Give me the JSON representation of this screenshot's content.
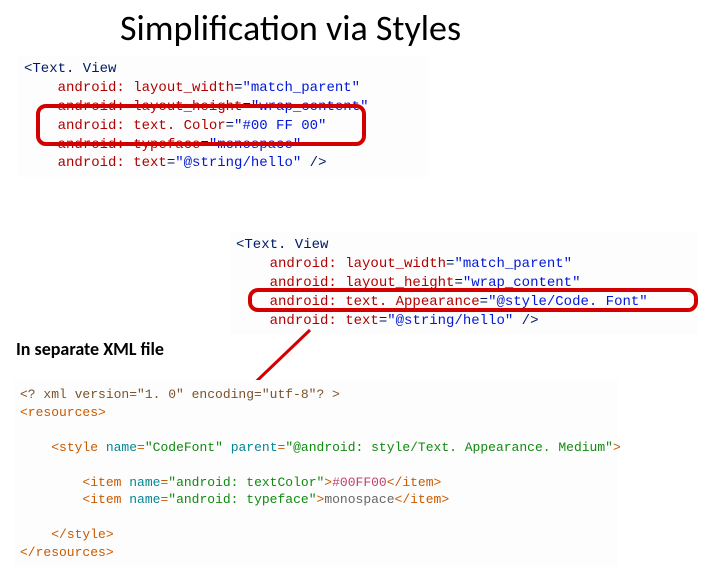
{
  "title": "Simplification via Styles",
  "caption": "In separate XML file",
  "block1": {
    "l1_open": "<Text. View",
    "l2_attr": "android: layout_width",
    "l2_val": "\"match_parent\"",
    "l3_attr": "android: layout_height",
    "l3_val": "\"wrap_content\"",
    "l4_attr": "android: text. Color",
    "l4_val": "\"#00 FF 00\"",
    "l5_attr": "android: typeface",
    "l5_val": "\"monospace\"",
    "l6_attr": "android: text",
    "l6_val": "\"@string/hello\"",
    "close": " />"
  },
  "block2": {
    "l1_open": "<Text. View",
    "l2_attr": "android: layout_width",
    "l2_val": "\"match_parent\"",
    "l3_attr": "android: layout_height",
    "l3_val": "\"wrap_content\"",
    "l4_attr": "android: text. Appearance",
    "l4_val": "\"@style/Code. Font\"",
    "l5_attr": "android: text",
    "l5_val": "\"@string/hello\"",
    "close": " />"
  },
  "block3": {
    "decl": "<? xml version=\"1. 0\" encoding=\"utf-8\"? >",
    "res_open": "<resources>",
    "style_open_a": "<style ",
    "style_name_k": "name",
    "style_name_v": "\"CodeFont\"",
    "style_parent_k": "parent",
    "style_parent_v": "\"@android: style/Text. Appearance. Medium\"",
    "gt": ">",
    "item1_open": "<item ",
    "item1_name_k": "name",
    "item1_name_v": "\"android: textColor\"",
    "item1_gt": ">",
    "item1_val": "#00FF00",
    "item1_close": "</item>",
    "item2_open": "<item ",
    "item2_name_k": "name",
    "item2_name_v": "\"android: typeface\"",
    "item2_gt": ">",
    "item2_val": "monospace",
    "item2_close": "</item>",
    "style_close": "</style>",
    "res_close": "</resources>"
  }
}
